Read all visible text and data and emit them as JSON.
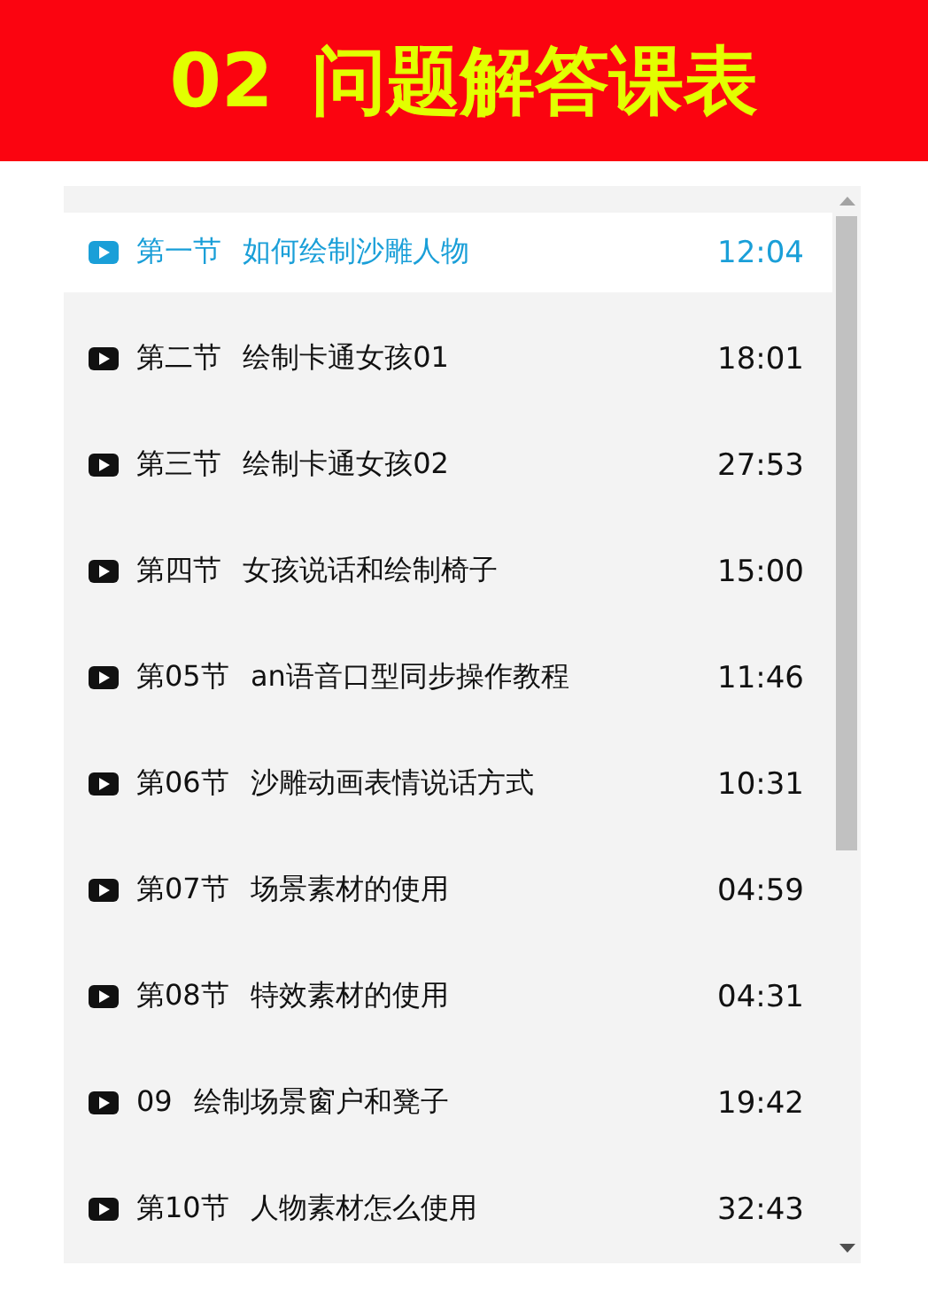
{
  "header": {
    "number": "02",
    "title": "问题解答课表"
  },
  "lessons": [
    {
      "title": "第一节 如何绘制沙雕人物",
      "duration": "12:04",
      "selected": true
    },
    {
      "title": "第二节 绘制卡通女孩01",
      "duration": "18:01",
      "selected": false
    },
    {
      "title": "第三节 绘制卡通女孩02",
      "duration": "27:53",
      "selected": false
    },
    {
      "title": "第四节 女孩说话和绘制椅子",
      "duration": "15:00",
      "selected": false
    },
    {
      "title": "第05节 an语音口型同步操作教程",
      "duration": "11:46",
      "selected": false
    },
    {
      "title": "第06节 沙雕动画表情说话方式",
      "duration": "10:31",
      "selected": false
    },
    {
      "title": "第07节 场景素材的使用",
      "duration": "04:59",
      "selected": false
    },
    {
      "title": "第08节 特效素材的使用",
      "duration": "04:31",
      "selected": false
    },
    {
      "title": "09 绘制场景窗户和凳子",
      "duration": "19:42",
      "selected": false
    },
    {
      "title": "第10节 人物素材怎么使用",
      "duration": "32:43",
      "selected": false
    }
  ]
}
